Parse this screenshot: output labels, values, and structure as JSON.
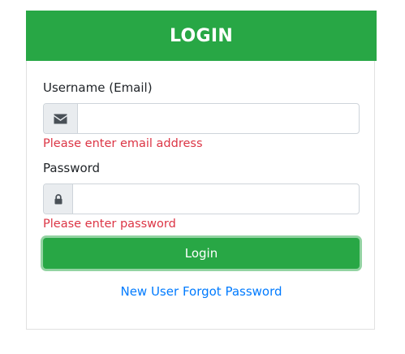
{
  "header": {
    "title": "LOGIN"
  },
  "form": {
    "username_label": "Username (Email)",
    "username_value": "",
    "username_error": "Please enter email address",
    "password_label": "Password",
    "password_value": "",
    "password_error": "Please enter password",
    "submit_label": "Login"
  },
  "links": {
    "new_user": "New User",
    "forgot_password": "Forgot Password"
  },
  "colors": {
    "header_bg": "#28a745",
    "error_text": "#dc3545",
    "link": "#007bff"
  },
  "icons": {
    "username_icon": "envelope-icon",
    "password_icon": "lock-icon"
  }
}
